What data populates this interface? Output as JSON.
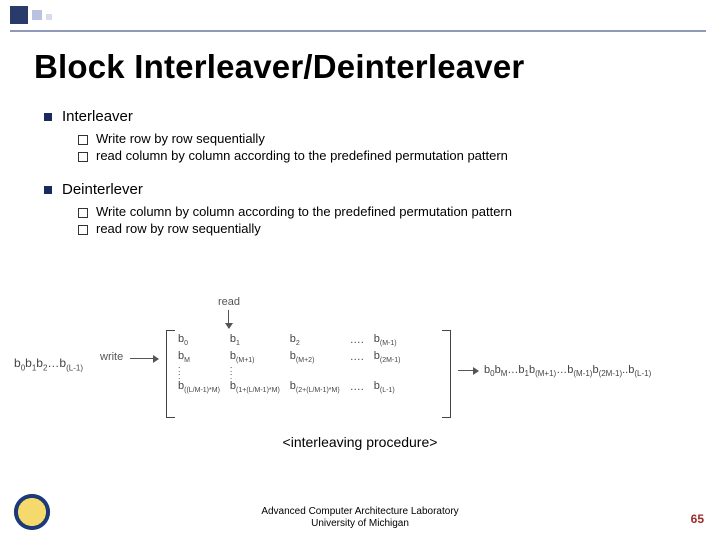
{
  "title": "Block Interleaver/Deinterleaver",
  "sections": [
    {
      "heading": "Interleaver",
      "items": [
        "Write row by row sequentially",
        "read column by column according to the predefined permutation pattern"
      ]
    },
    {
      "heading": "Deinterlever",
      "items": [
        "Write column by column according to the predefined permutation pattern",
        "read row by row sequentially"
      ]
    }
  ],
  "figure": {
    "write_label": "write",
    "read_label": "read",
    "input_sequence": "b₀b₁b₂…b(L-1)",
    "matrix_rows": [
      [
        "b₀",
        "b₁",
        "b₂",
        "….",
        "b(M-1)"
      ],
      [
        "bM",
        "b(M+1)",
        "b(M+2)",
        "….",
        "b(2M-1)"
      ],
      [
        "b((L/M-1)*M)",
        "b(1+(L/M-1)*M)",
        "b(2+(L/M-1)*M)",
        "….",
        "b(L-1)"
      ]
    ],
    "output_sequence": "b₀bM…b₁b(M+1)…b(M-1)b(2M-1)..b(L-1)"
  },
  "caption": "<interleaving procedure>",
  "footer": {
    "line1": "Advanced Computer Architecture Laboratory",
    "line2": "University of Michigan"
  },
  "page_number": "65"
}
